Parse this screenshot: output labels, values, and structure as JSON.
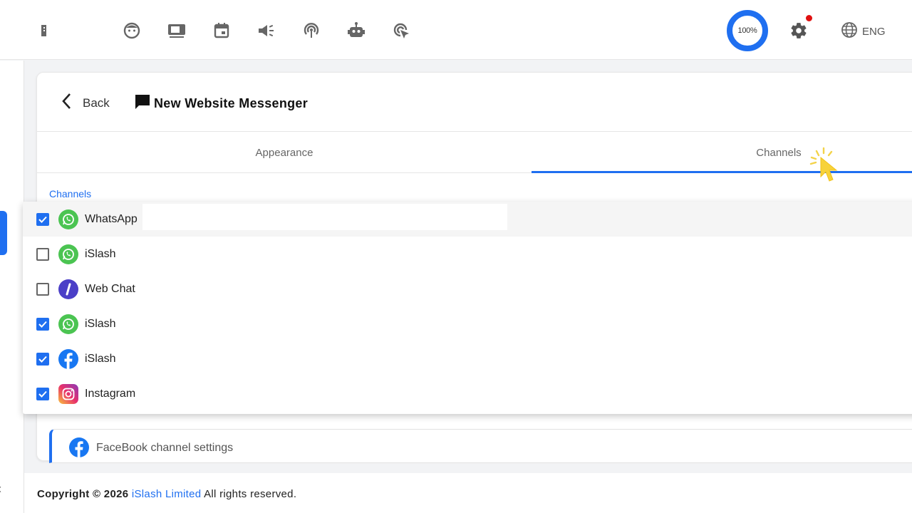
{
  "topbar": {
    "nav_icons": [
      "book-icon",
      "face-icon",
      "video-icon",
      "calendar-icon",
      "megaphone-icon",
      "podcast-icon",
      "robot-icon",
      "click-icon"
    ],
    "progress_label": "100%",
    "language": "ENG"
  },
  "header": {
    "back_label": "Back",
    "title": "New Website Messenger"
  },
  "tabs": [
    {
      "label": "Appearance",
      "active": false
    },
    {
      "label": "Channels",
      "active": true
    }
  ],
  "section_label": "Channels",
  "channels": [
    {
      "label": "WhatsApp",
      "checked": true,
      "icon": "whatsapp-icon"
    },
    {
      "label": "iSlash",
      "checked": false,
      "icon": "whatsapp-icon"
    },
    {
      "label": "Web Chat",
      "checked": false,
      "icon": "webchat-icon"
    },
    {
      "label": "iSlash",
      "checked": true,
      "icon": "whatsapp-icon"
    },
    {
      "label": "iSlash",
      "checked": true,
      "icon": "facebook-icon"
    },
    {
      "label": "Instagram",
      "checked": true,
      "icon": "instagram-icon"
    }
  ],
  "fb_settings_label": "FaceBook channel settings",
  "footer": {
    "prefix": "Copyright © 2026",
    "company": "iSlash Limited",
    "suffix": "All rights reserved."
  },
  "colors": {
    "accent": "#1f6ff0",
    "whatsapp": "#4bc452",
    "facebook": "#1877f2",
    "webchat": "#4b3fc7",
    "notification": "#e01010"
  }
}
